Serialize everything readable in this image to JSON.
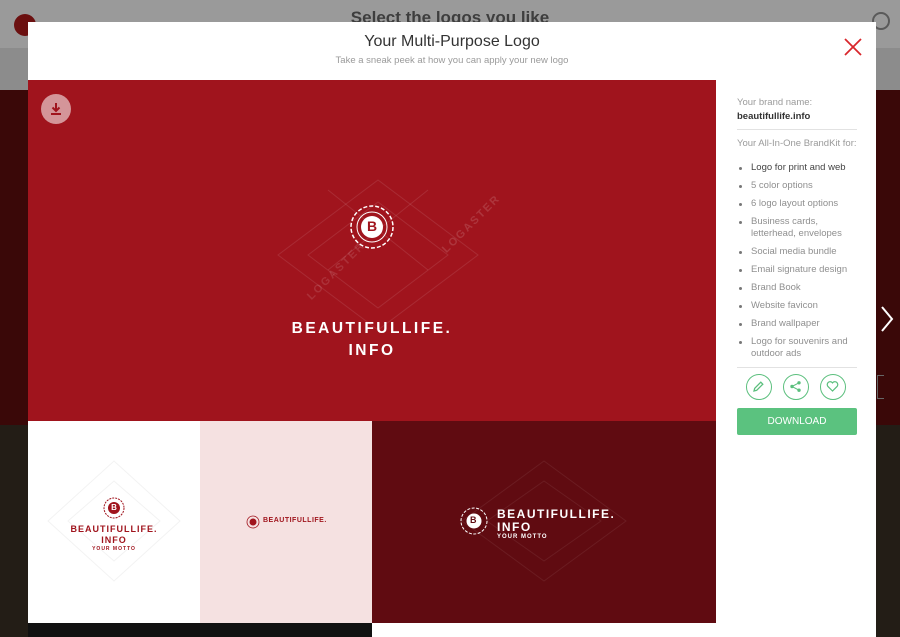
{
  "background": {
    "title": "Select the logos you like"
  },
  "modal": {
    "title": "Your Multi-Purpose Logo",
    "subtitle": "Take a sneak peek at how you can apply your new logo"
  },
  "logo": {
    "initial": "B",
    "line1": "BEAUTIFULLIFE.",
    "line2": "INFO",
    "motto": "YOUR MOTTO",
    "single_line": "BEAUTIFULLIFE."
  },
  "watermark": "LOGASTER",
  "sidebar": {
    "brand_label": "Your brand name:",
    "brand_name": "beautifullife.info",
    "kit_label": "Your All-In-One BrandKit for:",
    "features": [
      "Logo for print and web",
      "5 color options",
      "6 logo layout options",
      "Business cards, letterhead, envelopes",
      "Social media bundle",
      "Email signature design",
      "Brand Book",
      "Website favicon",
      "Brand wallpaper",
      "Logo for souvenirs and outdoor ads"
    ],
    "download_label": "DOWNLOAD"
  },
  "icons": {
    "close": "close-icon",
    "download": "download-icon",
    "edit": "pencil-icon",
    "share": "share-icon",
    "favorite": "heart-icon",
    "next": "chevron-right-icon"
  },
  "colors": {
    "brand_red": "#a0141d",
    "dark_red": "#600b11",
    "pink": "#f5e1e1",
    "accent_green": "#5bc27f",
    "close_red": "#d9262c"
  }
}
